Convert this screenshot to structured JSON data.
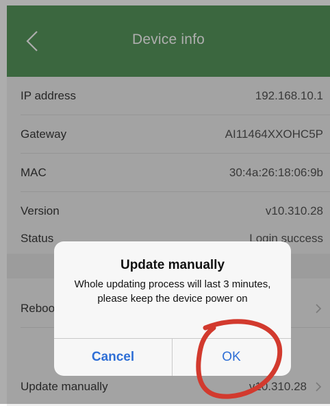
{
  "header": {
    "title": "Device info",
    "back_icon": "chevron-left-icon"
  },
  "rows": [
    {
      "label": "IP address",
      "value": "192.168.10.1"
    },
    {
      "label": "Gateway",
      "value": "AI11464XXOHC5P"
    },
    {
      "label": "MAC",
      "value": "30:4a:26:18:06:9b"
    },
    {
      "label": "Version",
      "value": "v10.310.28"
    },
    {
      "label": "Status",
      "value": "Login success"
    },
    {
      "label": "Reboot",
      "value": ""
    },
    {
      "label": "Update manually",
      "value": "v10.310.28"
    }
  ],
  "dialog": {
    "title": "Update manually",
    "message": "Whole updating process will last 3 minutes, please keep the device power on",
    "cancel_label": "Cancel",
    "ok_label": "OK"
  },
  "colors": {
    "header_bg": "#58995d",
    "button_text": "#2f6fd6",
    "annotation_circle": "#d23a2e"
  }
}
